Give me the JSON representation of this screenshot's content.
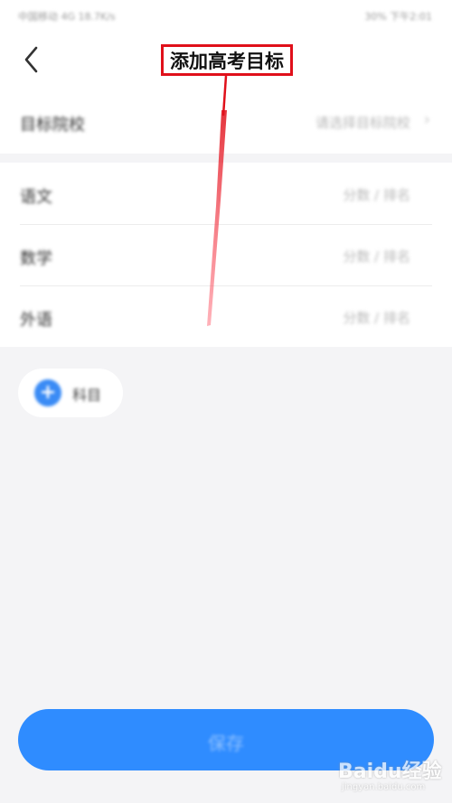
{
  "status_bar": {
    "left_text": "中国移动 4G 18.7K/s",
    "right_text": "30% 下午2:01"
  },
  "header": {
    "back_icon": "chevron-left-icon",
    "title": "添加高考目标"
  },
  "target_school": {
    "label": "目标院校",
    "placeholder": "请选择目标院校",
    "chevron_icon": "chevron-right-icon"
  },
  "subjects": [
    {
      "label": "语文",
      "placeholder": "分数 / 排名"
    },
    {
      "label": "数学",
      "placeholder": "分数 / 排名"
    },
    {
      "label": "外语",
      "placeholder": "分数 / 排名"
    }
  ],
  "add_subject": {
    "icon": "plus-circle-icon",
    "label": "科目"
  },
  "save_button": {
    "label": "保存",
    "color": "#2f8cff"
  },
  "annotation": {
    "highlight_color": "#e0101a"
  },
  "watermark": {
    "brand": "Baidu经验",
    "url": "jingyan.baidu.com"
  }
}
